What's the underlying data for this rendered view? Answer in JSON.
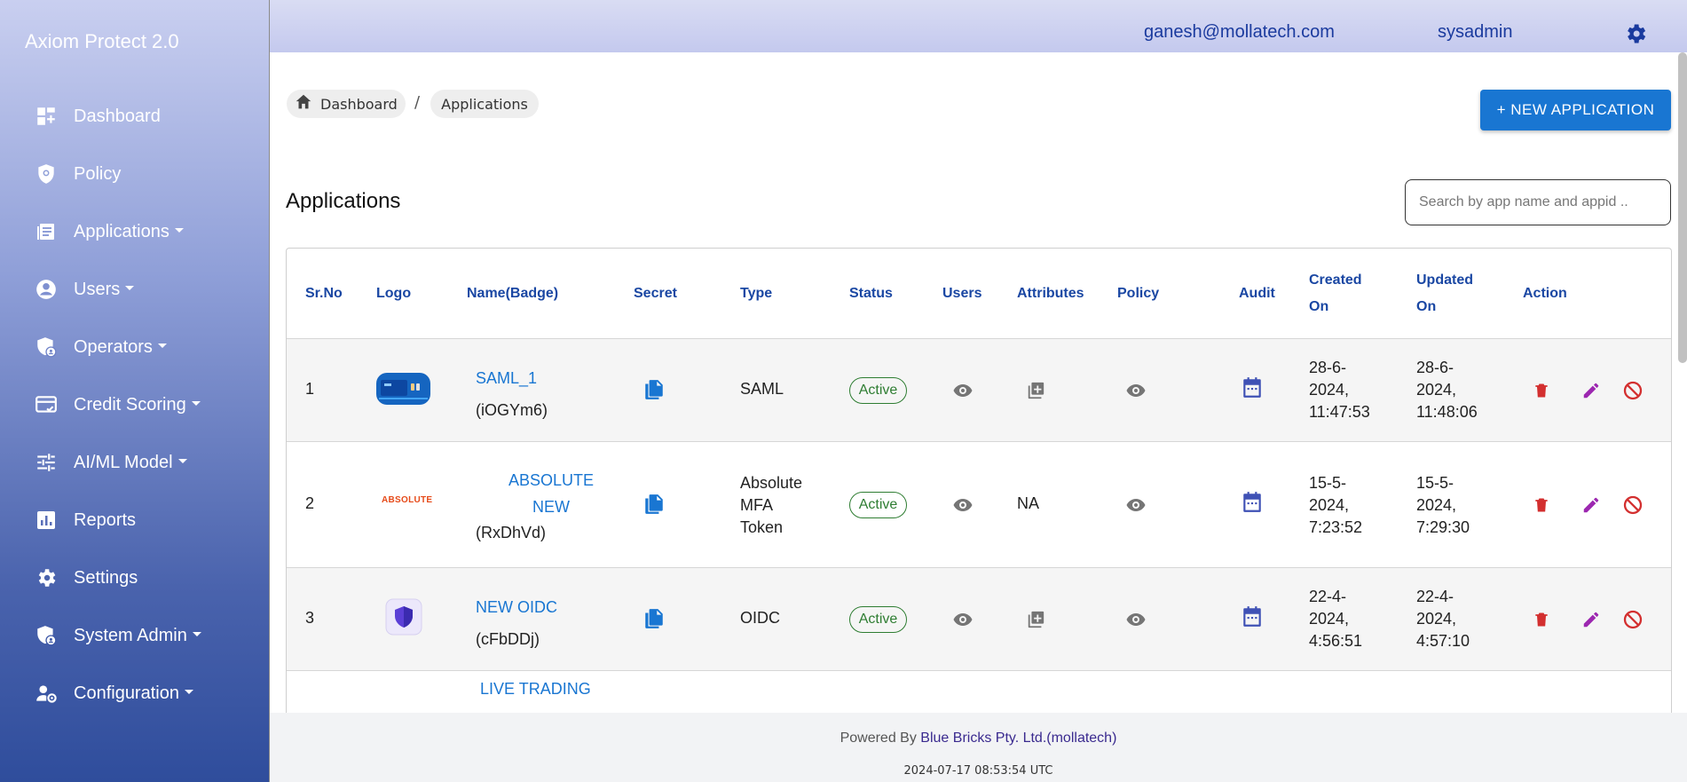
{
  "app": {
    "title": "Axiom Protect 2.0"
  },
  "sidebar": {
    "items": [
      {
        "label": "Dashboard",
        "icon": "dashboard-icon",
        "expandable": false
      },
      {
        "label": "Policy",
        "icon": "policy-shield-icon",
        "expandable": false
      },
      {
        "label": "Applications",
        "icon": "applications-icon",
        "expandable": true
      },
      {
        "label": "Users",
        "icon": "user-icon",
        "expandable": true
      },
      {
        "label": "Operators",
        "icon": "operator-shield-icon",
        "expandable": true
      },
      {
        "label": "Credit Scoring",
        "icon": "credit-card-icon",
        "expandable": true
      },
      {
        "label": "AI/ML Model",
        "icon": "tune-icon",
        "expandable": true
      },
      {
        "label": "Reports",
        "icon": "reports-icon",
        "expandable": false
      },
      {
        "label": "Settings",
        "icon": "gear-icon",
        "expandable": false
      },
      {
        "label": "System Admin",
        "icon": "admin-shield-icon",
        "expandable": true
      },
      {
        "label": "Configuration",
        "icon": "user-config-icon",
        "expandable": true
      }
    ]
  },
  "header": {
    "email": "ganesh@mollatech.com",
    "role": "sysadmin",
    "settings_icon": "gear-icon"
  },
  "breadcrumb": {
    "home": "Dashboard",
    "separator": "/",
    "current": "Applications"
  },
  "actions": {
    "new_application": "+ NEW APPLICATION"
  },
  "page": {
    "title": "Applications"
  },
  "search": {
    "placeholder": "Search by app name and appid ..",
    "value": ""
  },
  "table": {
    "columns": {
      "srno": "Sr.No",
      "logo": "Logo",
      "name": "Name(Badge)",
      "secret": "Secret",
      "type": "Type",
      "status": "Status",
      "users": "Users",
      "attributes": "Attributes",
      "policy": "Policy",
      "audit": "Audit",
      "created_1": "Created",
      "created_2": "On",
      "updated_1": "Updated",
      "updated_2": "On",
      "action": "Action"
    },
    "rows": [
      {
        "sr": "1",
        "logo": "SAML device image",
        "name": "SAML_1",
        "badge": "(iOGYm6)",
        "type": [
          "SAML"
        ],
        "status": "Active",
        "attributes": "icon",
        "created": [
          "28-6-",
          "2024,",
          "11:47:53"
        ],
        "updated": [
          "28-6-",
          "2024,",
          "11:48:06"
        ]
      },
      {
        "sr": "2",
        "logo": "ABSOLUTE",
        "name_lines": [
          "ABSOLUTE",
          "NEW"
        ],
        "badge": "(RxDhVd)",
        "type": [
          "Absolute",
          "MFA",
          "Token"
        ],
        "status": "Active",
        "attributes": "NA",
        "created": [
          "15-5-",
          "2024,",
          "7:23:52"
        ],
        "updated": [
          "15-5-",
          "2024,",
          "7:29:30"
        ]
      },
      {
        "sr": "3",
        "logo": "shield logo",
        "name": "NEW OIDC",
        "badge": "(cFbDDj)",
        "type": [
          "OIDC"
        ],
        "status": "Active",
        "attributes": "icon",
        "created": [
          "22-4-",
          "2024,",
          "4:56:51"
        ],
        "updated": [
          "22-4-",
          "2024,",
          "4:57:10"
        ]
      },
      {
        "name": "LIVE TRADING"
      }
    ]
  },
  "footer": {
    "powered_prefix": "Powered By ",
    "company": "Blue Bricks Pty. Ltd.(mollatech)",
    "timestamp": "2024-07-17 08:53:54 UTC"
  },
  "colors": {
    "accent": "#1976d2",
    "active": "#2e7d32",
    "delete": "#d32f2f",
    "edit": "#9c27b0",
    "link": "#1976d2"
  }
}
